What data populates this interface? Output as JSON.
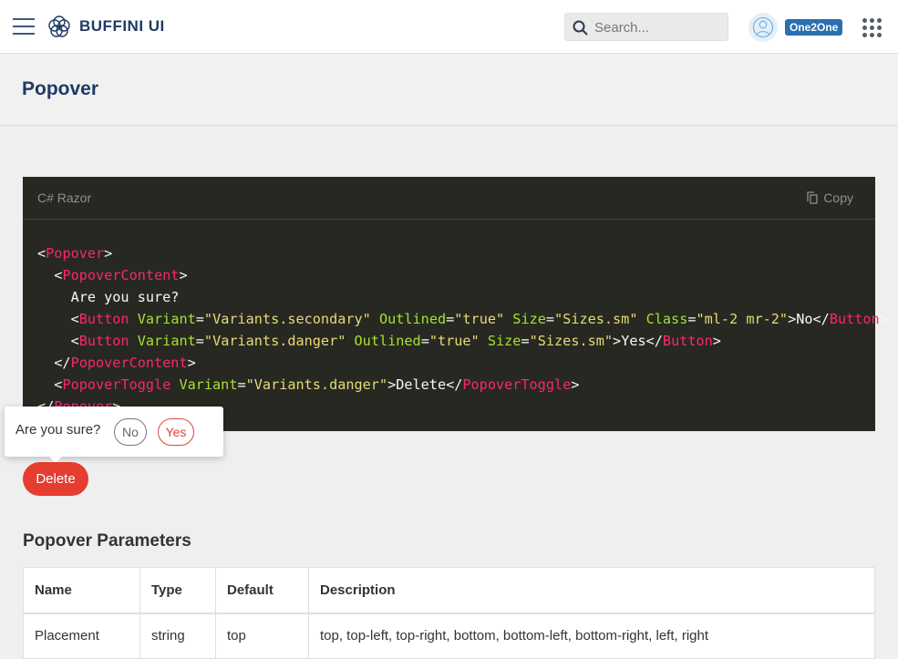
{
  "topbar": {
    "brand": "BUFFINI UI",
    "search_placeholder": "Search...",
    "badge": "One2One",
    "icons": [
      "menu-icon",
      "flower-logo",
      "search-icon",
      "user-icon",
      "apps-grid-icon"
    ]
  },
  "page": {
    "title": "Popover"
  },
  "code": {
    "language": "C# Razor",
    "copy_label": "Copy",
    "colors": {
      "background": "#272822",
      "tag": "#f92672",
      "attribute": "#a6e22e",
      "string": "#e6db74",
      "text": "#f8f8f2"
    },
    "lines": [
      [
        [
          "p",
          "<"
        ],
        [
          "tag",
          "Popover"
        ],
        [
          "p",
          ">"
        ]
      ],
      [
        [
          "p",
          "  <"
        ],
        [
          "tag",
          "PopoverContent"
        ],
        [
          "p",
          ">"
        ]
      ],
      [
        [
          "p",
          "    Are you sure?"
        ]
      ],
      [
        [
          "p",
          "    <"
        ],
        [
          "tag",
          "Button"
        ],
        [
          "p",
          " "
        ],
        [
          "attr",
          "Variant"
        ],
        [
          "p",
          "="
        ],
        [
          "str",
          "\"Variants.secondary\""
        ],
        [
          "p",
          " "
        ],
        [
          "attr",
          "Outlined"
        ],
        [
          "p",
          "="
        ],
        [
          "str",
          "\"true\""
        ],
        [
          "p",
          " "
        ],
        [
          "attr",
          "Size"
        ],
        [
          "p",
          "="
        ],
        [
          "str",
          "\"Sizes.sm\""
        ],
        [
          "p",
          " "
        ],
        [
          "attr",
          "Class"
        ],
        [
          "p",
          "="
        ],
        [
          "str",
          "\"ml-2 mr-2\""
        ],
        [
          "p",
          ">No</"
        ],
        [
          "tag",
          "Button"
        ],
        [
          "p",
          ">"
        ]
      ],
      [
        [
          "p",
          "    <"
        ],
        [
          "tag",
          "Button"
        ],
        [
          "p",
          " "
        ],
        [
          "attr",
          "Variant"
        ],
        [
          "p",
          "="
        ],
        [
          "str",
          "\"Variants.danger\""
        ],
        [
          "p",
          " "
        ],
        [
          "attr",
          "Outlined"
        ],
        [
          "p",
          "="
        ],
        [
          "str",
          "\"true\""
        ],
        [
          "p",
          " "
        ],
        [
          "attr",
          "Size"
        ],
        [
          "p",
          "="
        ],
        [
          "str",
          "\"Sizes.sm\""
        ],
        [
          "p",
          ">Yes</"
        ],
        [
          "tag",
          "Button"
        ],
        [
          "p",
          ">"
        ]
      ],
      [
        [
          "p",
          "  </"
        ],
        [
          "tag",
          "PopoverContent"
        ],
        [
          "p",
          ">"
        ]
      ],
      [
        [
          "p",
          "  <"
        ],
        [
          "tag",
          "PopoverToggle"
        ],
        [
          "p",
          " "
        ],
        [
          "attr",
          "Variant"
        ],
        [
          "p",
          "="
        ],
        [
          "str",
          "\"Variants.danger\""
        ],
        [
          "p",
          ">Delete</"
        ],
        [
          "tag",
          "PopoverToggle"
        ],
        [
          "p",
          ">"
        ]
      ],
      [
        [
          "p",
          "</"
        ],
        [
          "tag",
          "Popover"
        ],
        [
          "p",
          ">"
        ]
      ]
    ]
  },
  "popover": {
    "text": "Are you sure?",
    "no_label": "No",
    "yes_label": "Yes"
  },
  "demo": {
    "delete_label": "Delete",
    "danger_color": "#e53d30"
  },
  "params": {
    "title": "Popover Parameters",
    "headers": [
      "Name",
      "Type",
      "Default",
      "Description"
    ],
    "rows": [
      [
        "Placement",
        "string",
        "top",
        "top, top-left, top-right, bottom, bottom-left, bottom-right, left, right"
      ]
    ]
  }
}
